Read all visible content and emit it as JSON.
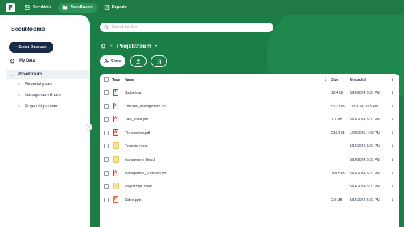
{
  "nav": {
    "items": [
      {
        "label": "SecuMails",
        "icon": "mail-icon",
        "active": false
      },
      {
        "label": "SecuRooms",
        "icon": "folder-icon",
        "active": true
      },
      {
        "label": "Reports",
        "icon": "report-icon",
        "active": false
      }
    ]
  },
  "sidebar": {
    "title": "SecuRooms",
    "create_label": "Create Dataroom",
    "my_data": "My Data",
    "current": "Projektraum",
    "children": [
      "Financial years",
      "Management Board",
      "Project high tower"
    ]
  },
  "search": {
    "placeholder": "Search for files"
  },
  "breadcrumb": {
    "current": "Projektraum"
  },
  "actions": {
    "share": "Share"
  },
  "table": {
    "headers": {
      "type": "Type",
      "name": "Name",
      "size": "Size",
      "uploaded": "Uploaded"
    },
    "rows": [
      {
        "type": "csv",
        "name": "Budget.csv",
        "size": "13.4 kB",
        "uploaded": "5/14/2024, 5:01 PM"
      },
      {
        "type": "csv",
        "name": "Checklist_Management.csv",
        "size": "521.3 kB",
        "uploaded": "7/8/2024, 3:18 PM"
      },
      {
        "type": "pdf",
        "name": "Data_sheet.pdf",
        "size": "1.7 MB",
        "uploaded": "5/14/2024, 5:01 PM"
      },
      {
        "type": "pdf",
        "name": "File-example.pdf",
        "size": "210.1 kB",
        "uploaded": "1/28/2025, 4:42 PM"
      },
      {
        "type": "folder",
        "name": "Financial years",
        "size": "",
        "uploaded": "5/14/2024, 5:01 PM"
      },
      {
        "type": "folder",
        "name": "Management Board",
        "size": "",
        "uploaded": "5/14/2024, 5:01 PM"
      },
      {
        "type": "pdf",
        "name": "Management_Summary.pdf",
        "size": "109.5 kB",
        "uploaded": "5/14/2024, 5:01 PM"
      },
      {
        "type": "folder",
        "name": "Project high tower",
        "size": "",
        "uploaded": "5/14/2024, 5:01 PM"
      },
      {
        "type": "pptx",
        "name": "Slides.pptx",
        "size": "2.6 MB",
        "uploaded": "5/14/2024, 5:01 PM"
      }
    ]
  }
}
